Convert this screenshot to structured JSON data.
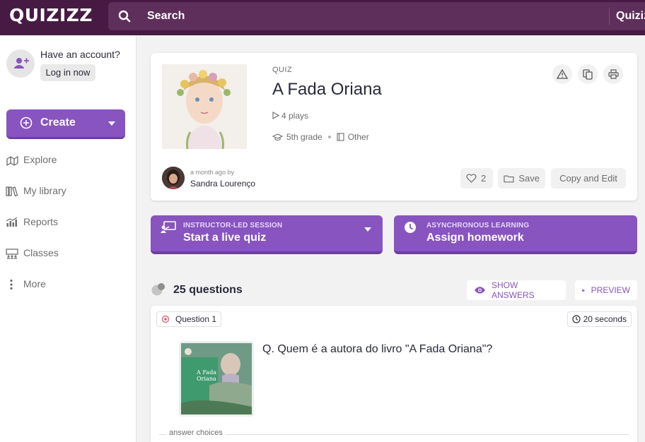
{
  "brand": {
    "logo_text": "QUIZIZZ",
    "accent": "#8854c0",
    "topbar": "#461a42"
  },
  "search": {
    "label": "Search",
    "right_label": "Quizizz"
  },
  "sidebar": {
    "have_account": "Have an account?",
    "login": "Log in now",
    "create": "Create",
    "items": [
      {
        "label": "Explore",
        "icon": "explore-icon"
      },
      {
        "label": "My library",
        "icon": "library-icon"
      },
      {
        "label": "Reports",
        "icon": "reports-icon"
      },
      {
        "label": "Classes",
        "icon": "classes-icon"
      },
      {
        "label": "More",
        "icon": "more-icon"
      }
    ]
  },
  "quiz": {
    "type_label": "QUIZ",
    "title": "A Fada Oriana",
    "plays": "4 plays",
    "grade": "5th grade",
    "subject": "Other",
    "ago": "a month ago by",
    "author": "Sandra Lourenço",
    "likes": "2",
    "save": "Save",
    "copy_edit": "Copy and Edit"
  },
  "actions": {
    "live": {
      "small": "INSTRUCTOR-LED SESSION",
      "big": "Start a live quiz"
    },
    "homework": {
      "small": "ASYNCHRONOUS LEARNING",
      "big": "Assign homework"
    }
  },
  "questions": {
    "count": "25 questions",
    "show_answers": "SHOW ANSWERS",
    "preview": "PREVIEW"
  },
  "question1": {
    "badge": "Question 1",
    "time": "20 seconds",
    "text": "Q. Quem é a autora do livro \"A Fada Oriana\"?",
    "answers_label": "answer choices",
    "cover_title_1": "A Fada",
    "cover_title_2": "Oriana"
  }
}
